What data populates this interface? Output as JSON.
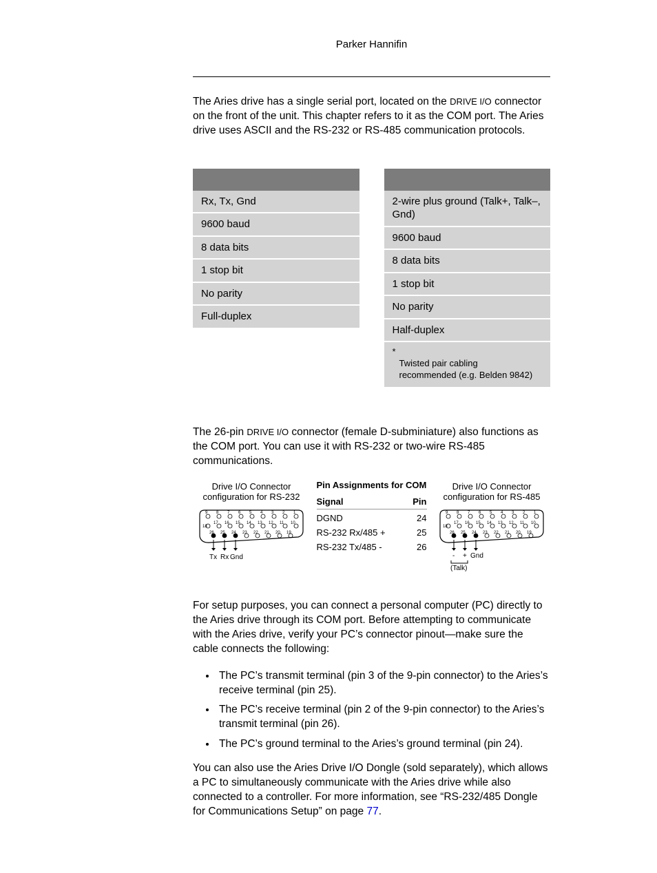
{
  "header": "Parker Hannifin",
  "intro": {
    "t1": "The Aries drive has a single serial port, located on the ",
    "t2": "DRIVE I/O",
    "t3": " connector on the front of the unit. This chapter refers to it as the COM port. The Aries drive uses ASCII and the RS-232 or RS-485 communication protocols."
  },
  "rs232": {
    "r0": "Rx, Tx, Gnd",
    "r1": "9600 baud",
    "r2": "8 data bits",
    "r3": "1 stop bit",
    "r4": "No parity",
    "r5": "Full-duplex"
  },
  "rs485": {
    "r0": "2-wire plus ground (Talk+, Talk–, Gnd)",
    "r1": "9600 baud",
    "r2": "8 data bits",
    "r3": "1 stop bit",
    "r4": "No parity",
    "r5": "Half-duplex",
    "note_star": "*",
    "note": "Twisted pair cabling recommended (e.g. Belden 9842)"
  },
  "mid": {
    "t1": "The 26-pin ",
    "t2": "DRIVE I/O",
    "t3": " connector (female D-subminiature) also functions as the COM port. You can use it with RS-232 or two-wire RS-485 communications."
  },
  "diag": {
    "left_caption_l1": "Drive I/O Connector",
    "left_caption_l2": "configuration for RS-232",
    "left_tx": "Tx",
    "left_rx": "Rx",
    "left_gnd": "Gnd",
    "right_caption_l1": "Drive I/O Connector",
    "right_caption_l2": "configuration for RS-485",
    "right_minus": "-",
    "right_plus": "+",
    "right_gnd": "Gnd",
    "right_talk": "(Talk)"
  },
  "pin_table": {
    "title": "Pin Assignments for COM",
    "h_sig": "Signal",
    "h_pin": "Pin",
    "r0_s": "DGND",
    "r0_p": "24",
    "r1_s": "RS-232 Rx/485 +",
    "r1_p": "25",
    "r2_s": "RS-232 Tx/485 -",
    "r2_p": "26"
  },
  "setup_para": "For setup purposes, you can connect a personal computer (PC) directly to the Aries drive through its COM port. Before attempting to communicate with the Aries drive, verify your PC’s connector pinout—make sure the cable connects the following:",
  "bullets": {
    "b0": "The PC’s transmit terminal (pin 3 of the 9-pin connector) to the Aries’s receive terminal (pin 25).",
    "b1": "The PC’s receive terminal (pin 2 of the 9-pin connector) to the Aries’s transmit terminal (pin 26).",
    "b2": "The PC’s ground terminal to the Aries’s ground terminal (pin 24)."
  },
  "tail": {
    "t1": "You can also use the Aries Drive I/O Dongle (sold separately), which allows a PC to simultaneously communicate with the Aries drive while also connected to a controller. For more information, see “RS-232/485 Dongle for Communications Setup” on page ",
    "link": "77",
    "t2": "."
  }
}
